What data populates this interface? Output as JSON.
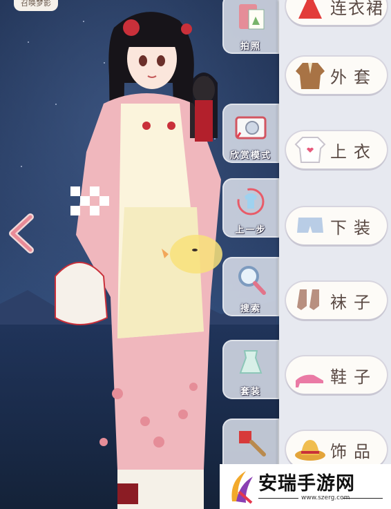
{
  "top_tag": "召唤梦影",
  "tools": [
    {
      "name": "tool-camera-frame",
      "label": "拍照",
      "icon": "notebook-icon"
    },
    {
      "name": "tool-photo-mode",
      "label": "欣赏模式",
      "icon": "camera-icon"
    },
    {
      "name": "tool-undo",
      "label": "上一步",
      "icon": "undo-shirt-icon"
    },
    {
      "name": "tool-search",
      "label": "搜索",
      "icon": "magnifier-icon"
    },
    {
      "name": "tool-outfit",
      "label": "套装",
      "icon": "dress-set-icon"
    },
    {
      "name": "tool-paint",
      "label": "",
      "icon": "paint-brush-icon"
    }
  ],
  "categories": [
    {
      "name": "category-dress",
      "label": "连衣裙",
      "icon": "dress-icon"
    },
    {
      "name": "category-coat",
      "label": "外套",
      "icon": "coat-icon"
    },
    {
      "name": "category-top",
      "label": "上衣",
      "icon": "tshirt-icon"
    },
    {
      "name": "category-bottom",
      "label": "下装",
      "icon": "shorts-icon"
    },
    {
      "name": "category-socks",
      "label": "袜子",
      "icon": "socks-icon"
    },
    {
      "name": "category-shoes",
      "label": "鞋子",
      "icon": "heels-icon"
    },
    {
      "name": "category-accessory",
      "label": "饰品",
      "icon": "hat-icon"
    }
  ],
  "watermark": {
    "title": "安瑞手游网",
    "url": "www.szerg.com"
  },
  "colors": {
    "panel": "#e7e9f0",
    "button": "#fdfbf7",
    "kimono": "#f0b7bd",
    "sky": "#1d2e4f"
  }
}
